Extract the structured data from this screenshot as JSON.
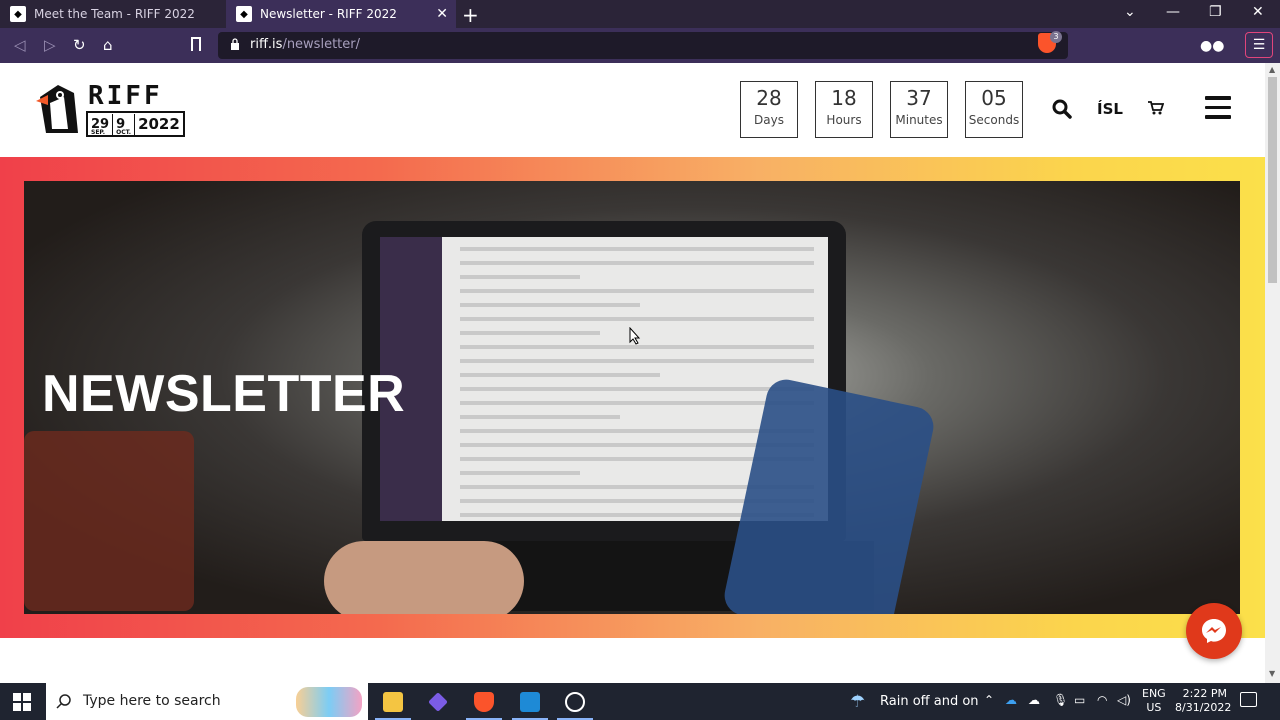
{
  "browser": {
    "tabs": [
      {
        "title": "Meet the Team - RIFF 2022",
        "active": false
      },
      {
        "title": "Newsletter - RIFF 2022",
        "active": true
      }
    ],
    "url": {
      "host": "riff.is",
      "path": "/newsletter/"
    },
    "shield_count": "3"
  },
  "header": {
    "logo": {
      "wordmark": "RIFF",
      "start_day": "29",
      "start_month": "SEP.",
      "end_day": "9",
      "end_month": "OCT.",
      "year": "2022"
    },
    "countdown": [
      {
        "value": "28",
        "label": "Days"
      },
      {
        "value": "18",
        "label": "Hours"
      },
      {
        "value": "37",
        "label": "Minutes"
      },
      {
        "value": "05",
        "label": "Seconds"
      }
    ],
    "language": "ÍSL"
  },
  "hero": {
    "title": "NEWSLETTER"
  },
  "taskbar": {
    "search_placeholder": "Type here to search",
    "weather": "Rain off and on",
    "lang_top": "ENG",
    "lang_bottom": "US",
    "time": "2:22 PM",
    "date": "8/31/2022"
  },
  "colors": {
    "brand_banner_start": "#f0404a",
    "brand_banner_end": "#fbe04a",
    "messenger": "#e0391b",
    "browser_chrome": "#3c2f59"
  }
}
